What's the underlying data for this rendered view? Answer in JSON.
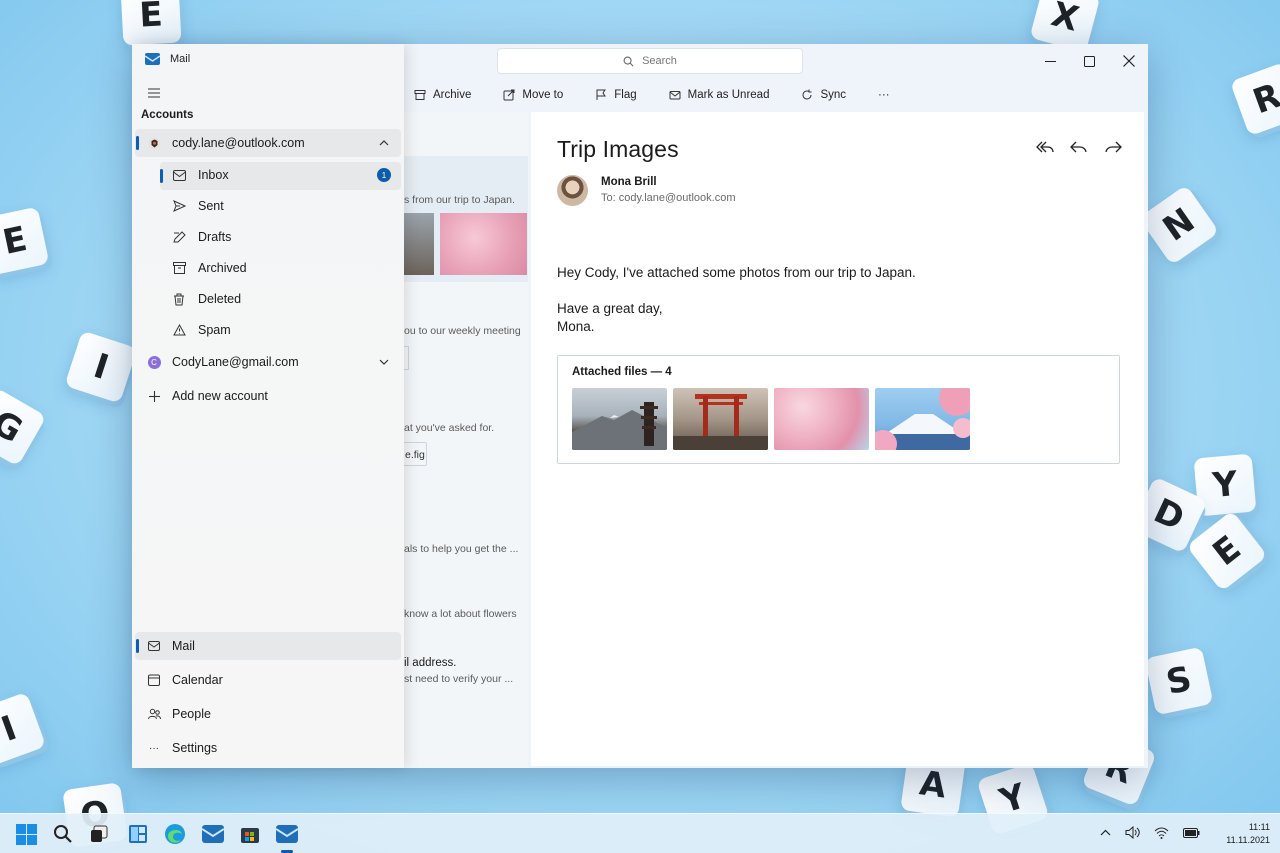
{
  "window": {
    "app_title": "Mail",
    "search_placeholder": "Search"
  },
  "toolbar": {
    "archive": "Archive",
    "move_to": "Move to",
    "flag": "Flag",
    "mark_unread": "Mark as Unread",
    "sync": "Sync",
    "more": "···"
  },
  "drawer": {
    "accounts_label": "Accounts",
    "account1": "cody.lane@outlook.com",
    "folders": [
      {
        "label": "Inbox",
        "icon": "mail-icon",
        "badge": "1"
      },
      {
        "label": "Sent",
        "icon": "send-icon"
      },
      {
        "label": "Drafts",
        "icon": "drafts-icon"
      },
      {
        "label": "Archived",
        "icon": "archive-icon"
      },
      {
        "label": "Deleted",
        "icon": "trash-icon"
      },
      {
        "label": "Spam",
        "icon": "warning-icon"
      }
    ],
    "account2": "CodyLane@gmail.com",
    "account2_initial": "C",
    "add_account": "Add new account",
    "bottom_nav": [
      {
        "label": "Mail",
        "icon": "mail-icon"
      },
      {
        "label": "Calendar",
        "icon": "calendar-icon"
      },
      {
        "label": "People",
        "icon": "people-icon"
      },
      {
        "label": "Settings",
        "icon": "more-icon"
      }
    ]
  },
  "message_list": {
    "previews": [
      "s from our trip to Japan.",
      "ou to our weekly meeting",
      "at you've asked for.",
      "e.fig",
      "als to help you get the ...",
      "know a lot about flowers",
      "il address.",
      "st need to verify your ..."
    ]
  },
  "message": {
    "subject": "Trip Images",
    "sender": "Mona Brill",
    "to": "To: cody.lane@outlook.com",
    "body_line1": "Hey Cody, I've attached some photos from our trip to Japan.",
    "body_line2": "Have a great day,",
    "body_line3": "Mona.",
    "attachments_title": "Attached files — 4"
  },
  "taskbar": {
    "time": "11:11",
    "date": "11.11.2021"
  },
  "colors": {
    "accent": "#0a5fb4",
    "badge": "#0b5cad",
    "gmail_avatar": "#8a6fd6"
  }
}
